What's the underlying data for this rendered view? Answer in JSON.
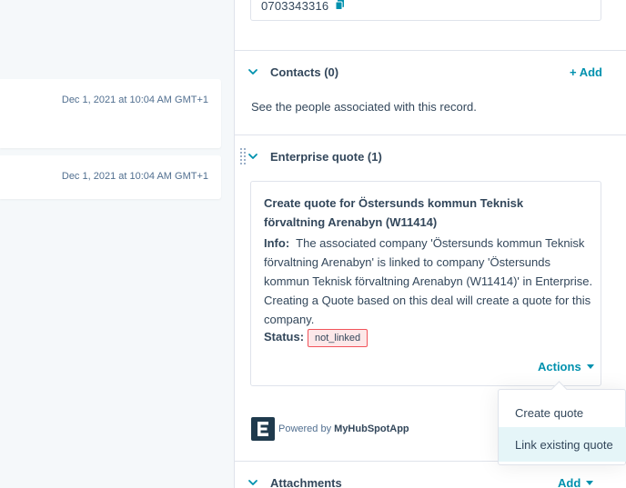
{
  "timeline": {
    "items": [
      {
        "timestamp": "Dec 1, 2021 at 10:04 AM GMT+1"
      },
      {
        "timestamp": "Dec 1, 2021 at 10:04 AM GMT+1"
      }
    ]
  },
  "sidebar": {
    "phone": {
      "value": "0703343316",
      "icon": "copy-icon"
    },
    "contacts": {
      "title": "Contacts (0)",
      "add_label": "+ Add",
      "description": "See the people associated with this record."
    },
    "enterprise_quote": {
      "title": "Enterprise quote (1)",
      "card": {
        "title": "Create quote for Östersunds kommun Teknisk förvaltning Arenabyn (W11414)",
        "info_label": "Info:",
        "info_text": "The associated company 'Östersunds kommun Teknisk förvaltning Arenabyn' is linked to company 'Östersunds kommun Teknisk förvaltning Arenabyn (W11414)' in Enterprise. Creating a Quote based on this deal will create a quote for this company.",
        "status_label": "Status:",
        "status_value": "not_linked",
        "actions_label": "Actions"
      },
      "powered_prefix": "Powered by",
      "powered_brand": "MyHubSpotApp"
    },
    "attachments": {
      "title": "Attachments",
      "add_label": "Add"
    }
  },
  "actions_menu": {
    "items": [
      {
        "label": "Create quote"
      },
      {
        "label": "Link existing quote"
      }
    ]
  },
  "colors": {
    "accent": "#0091ae",
    "text": "#33475b",
    "border": "#dfe3eb",
    "status_bg": "#fde8e9",
    "status_border": "#f2545b",
    "hover_bg": "#e5f5f8",
    "logo": "#1f3a4d"
  }
}
